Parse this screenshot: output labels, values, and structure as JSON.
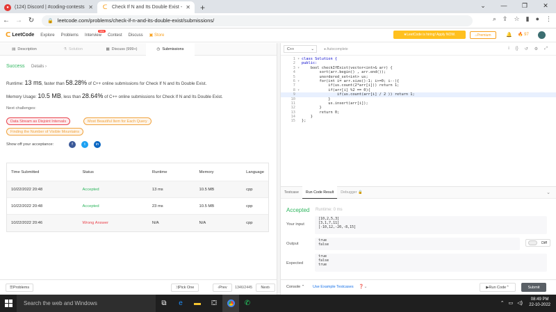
{
  "browser": {
    "tabs": [
      {
        "title": "(124) Discord | #coding-contests",
        "icon": "discord-icon"
      },
      {
        "title": "Check If N and Its Double Exist -",
        "icon": "leetcode-icon"
      }
    ],
    "url": "leetcode.com/problems/check-if-n-and-its-double-exist/submissions/"
  },
  "nav": {
    "logo": "LeetCode",
    "items": [
      "Explore",
      "Problems",
      "Interview",
      "Contest",
      "Discuss"
    ],
    "new_badge": "New",
    "store": "Store",
    "promo": "LeetCode is hiring! Apply NOW.",
    "premium": "Premium",
    "streak": "97"
  },
  "left_tabs": [
    "Description",
    "Solution",
    "Discuss (999+)",
    "Submissions"
  ],
  "result": {
    "status": "Success",
    "details": "Details",
    "runtime_pre": "Runtime:",
    "runtime": "13 ms",
    "runtime_mid": ", faster than",
    "runtime_pct": "58.28%",
    "runtime_post": "of C++ online submissions for Check If N and Its Double Exist.",
    "mem_pre": "Memory Usage:",
    "mem": "10.5 MB",
    "mem_mid": ", less than",
    "mem_pct": "28.64%",
    "mem_post": "of C++ online submissions for Check If N and Its Double Exist.",
    "next_label": "Next challenges:",
    "challenges": [
      "Data Stream as Disjoint Intervals",
      "Most Beautiful Item for Each Query",
      "Finding the Number of Visible Mountains"
    ],
    "share": "Show off your acceptance:"
  },
  "table": {
    "headers": [
      "Time Submitted",
      "Status",
      "Runtime",
      "Memory",
      "Language"
    ],
    "rows": [
      [
        "10/22/2022 20:48",
        "Accepted",
        "13 ms",
        "10.5 MB",
        "cpp"
      ],
      [
        "10/22/2022 20:48",
        "Accepted",
        "23 ms",
        "10.5 MB",
        "cpp"
      ],
      [
        "10/22/2022 20:46",
        "Wrong Answer",
        "N/A",
        "N/A",
        "cpp"
      ]
    ]
  },
  "left_bottom": {
    "problems": "Problems",
    "pick_one": "Pick One",
    "prev": "Prev",
    "page": "1346/2445",
    "next": "Next"
  },
  "editor": {
    "language": "C++",
    "autocomplete": "Autocomplete",
    "lines": [
      "class Solution {",
      "public:",
      "    bool checkIfExist(vector<int>& arr) {",
      "        sort(arr.begin() , arr.end());",
      "        unordered_set<int> us;",
      "        for(int i= arr.size()-1; i>=0; i--){",
      "            if(us.count(2*arr[i])) return 1;",
      "            if(arr[i] %2 == 0){",
      "                if(us.count(arr[i] / 2 )) return 1;",
      "            }",
      "            us.insert(arr[i]);",
      "        }",
      "        return 0;",
      "    }",
      "};"
    ]
  },
  "console": {
    "tabs": [
      "Testcase",
      "Run Code Result",
      "Debugger"
    ],
    "accepted": "Accepted",
    "runtime": "Runtime: 0 ms",
    "input_label": "Your input",
    "input": [
      "[10,2,5,3]",
      "[3,1,7,11]",
      "[-10,12,-20,-8,15]"
    ],
    "output_label": "Output",
    "output": [
      "true",
      "false"
    ],
    "expected_label": "Expected",
    "expected": [
      "true",
      "false",
      "true"
    ],
    "diff": "Diff"
  },
  "right_bottom": {
    "console": "Console",
    "example": "Use Example Testcases",
    "run": "Run Code",
    "submit": "Submit"
  },
  "taskbar": {
    "search": "Search the web and Windows",
    "time": "08:49 PM",
    "date": "22-10-2022"
  }
}
